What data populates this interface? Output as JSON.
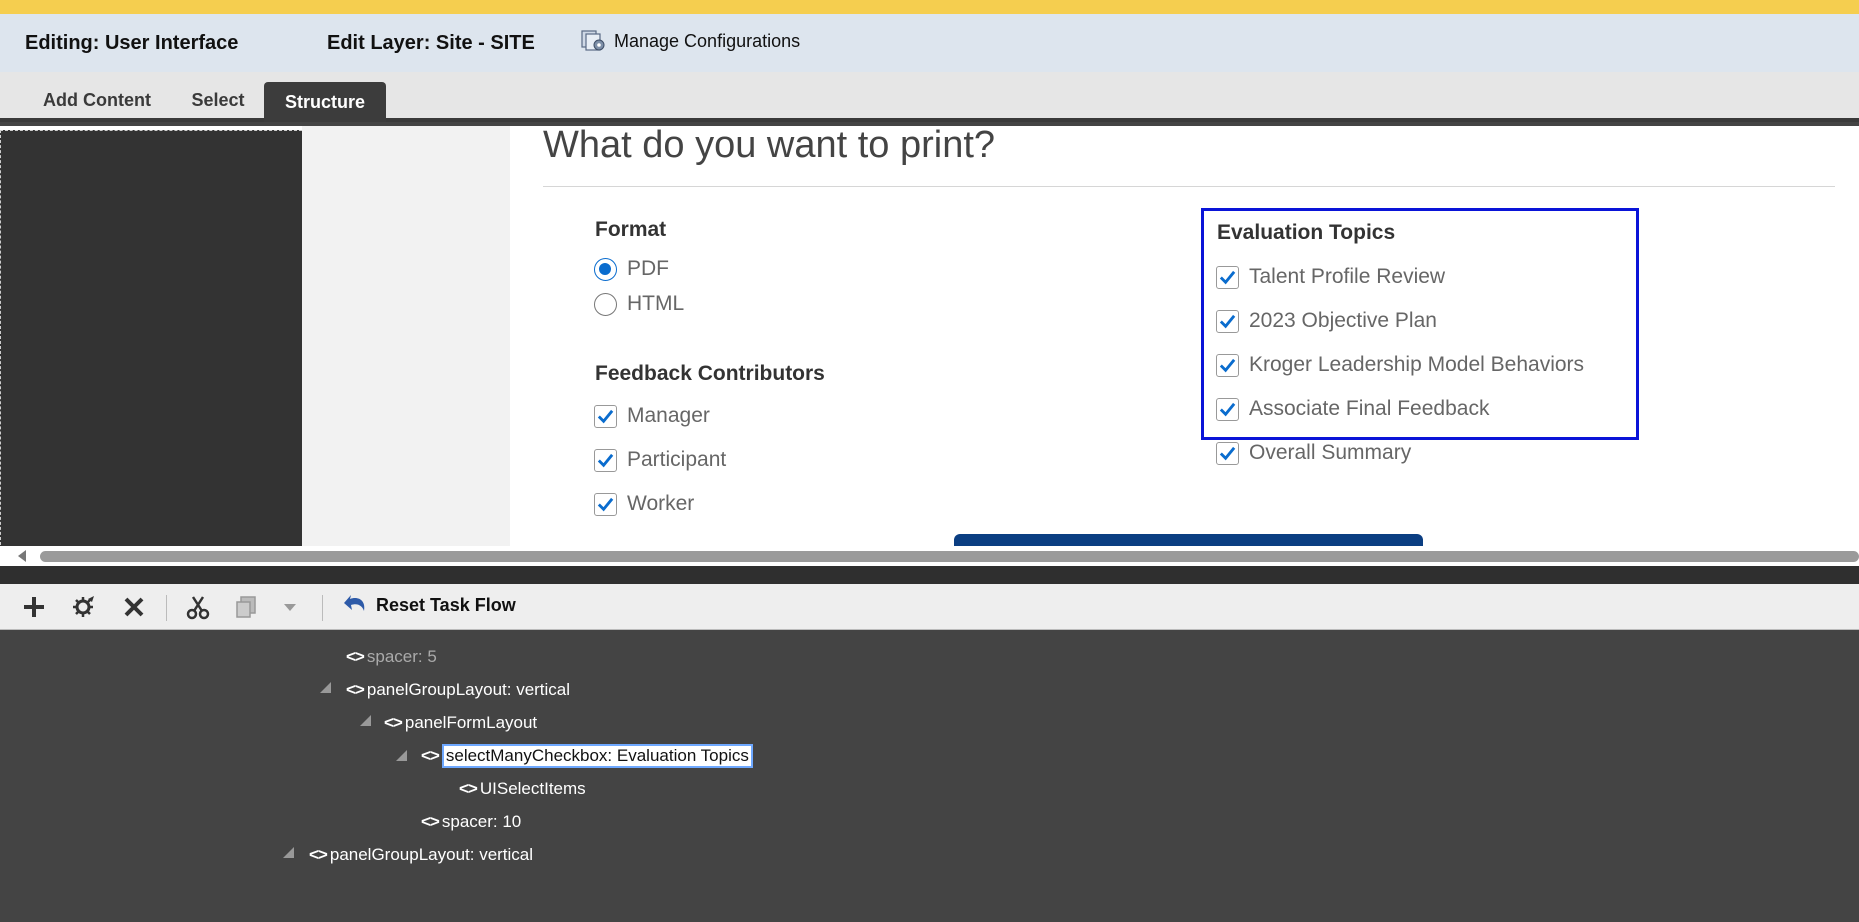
{
  "editbar": {
    "editing": "Editing: User Interface",
    "edit_layer": "Edit Layer: Site - SITE",
    "manage_configurations": "Manage Configurations"
  },
  "tabs": [
    "Add Content",
    "Select",
    "Structure"
  ],
  "active_tab": "Structure",
  "print_form": {
    "heading": "What do you want to print?",
    "format": {
      "title": "Format",
      "options": [
        "PDF",
        "HTML"
      ],
      "selected": "PDF"
    },
    "feedback_contributors": {
      "title": "Feedback Contributors",
      "items": [
        "Manager",
        "Participant",
        "Worker"
      ]
    },
    "evaluation_topics": {
      "title": "Evaluation Topics",
      "items": [
        "Talent Profile Review",
        "2023 Objective Plan",
        "Kroger Leadership Model Behaviors",
        "Associate Final Feedback",
        "Overall Summary"
      ]
    }
  },
  "toolbar": {
    "buttons": [
      "add-icon",
      "edit-properties-icon",
      "delete-icon",
      "cut-icon",
      "paste-icon",
      "dropdown-icon"
    ],
    "reset_label": "Reset Task Flow"
  },
  "tree": {
    "nodes": [
      {
        "label": "spacer: 5",
        "tag": "<>"
      },
      {
        "label": "panelGroupLayout: vertical",
        "tag": "<>",
        "expanded": true
      },
      {
        "label": "panelFormLayout",
        "tag": "<>",
        "expanded": true
      },
      {
        "label": "selectManyCheckbox: Evaluation Topics",
        "tag": "<>",
        "expanded": true,
        "selected": true
      },
      {
        "label": "UISelectItems",
        "tag": "<>"
      },
      {
        "label": "spacer: 10",
        "tag": "<>"
      },
      {
        "label": "panelGroupLayout: vertical",
        "tag": "<>",
        "expanded": true
      }
    ]
  },
  "colors": {
    "top_stripe": "#f5ce4f",
    "edit_bar": "#dde5ee",
    "check_blue": "#0a6cce",
    "selection_border": "#0a14d8",
    "tree_background": "#444444"
  }
}
